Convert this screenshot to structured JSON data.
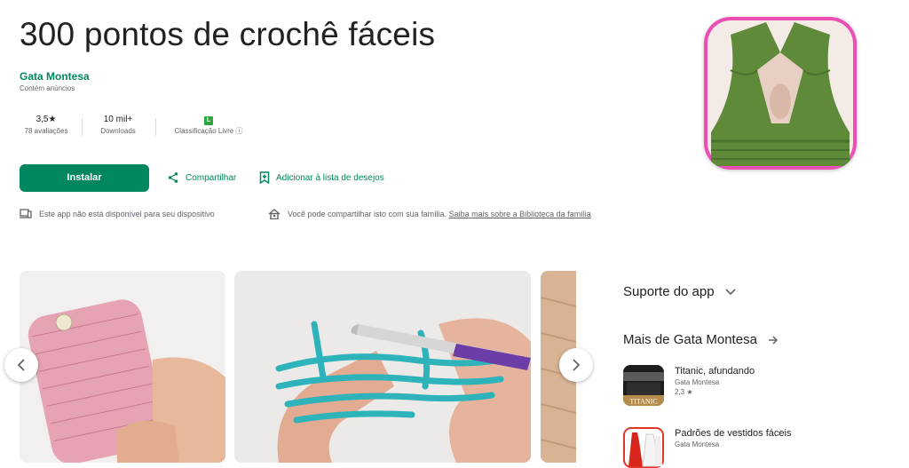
{
  "app": {
    "title": "300 pontos de crochê fáceis",
    "developer": "Gata Montesa",
    "ads_note": "Contém anúncios"
  },
  "stats": {
    "rating": {
      "value": "3,5★",
      "label": "78 avaliações"
    },
    "downloads": {
      "value": "10 mil+",
      "label": "Downloads"
    },
    "content_rating": {
      "badge": "L",
      "label": "Classificação Livre ⓘ"
    }
  },
  "actions": {
    "install": "Instalar",
    "share": "Compartilhar",
    "wishlist": "Adicionar à lista de desejos"
  },
  "notes": {
    "device": "Este app não está disponível para seu dispositivo",
    "family": "Você pode compartilhar isto com sua família.",
    "family_link": "Saiba mais sobre a Biblioteca da família"
  },
  "sidebar": {
    "support": "Suporte do app",
    "more_from": "Mais de Gata Montesa",
    "apps": [
      {
        "name": "Titanic, afundando",
        "developer": "Gata Montesa",
        "rating": "2,3 ★",
        "icon_text": "TITANIC"
      },
      {
        "name": "Padrões de vestidos fáceis",
        "developer": "Gata Montesa",
        "rating": ""
      }
    ]
  },
  "colors": {
    "accent": "#01875f",
    "rating_badge": "#2ba640"
  }
}
